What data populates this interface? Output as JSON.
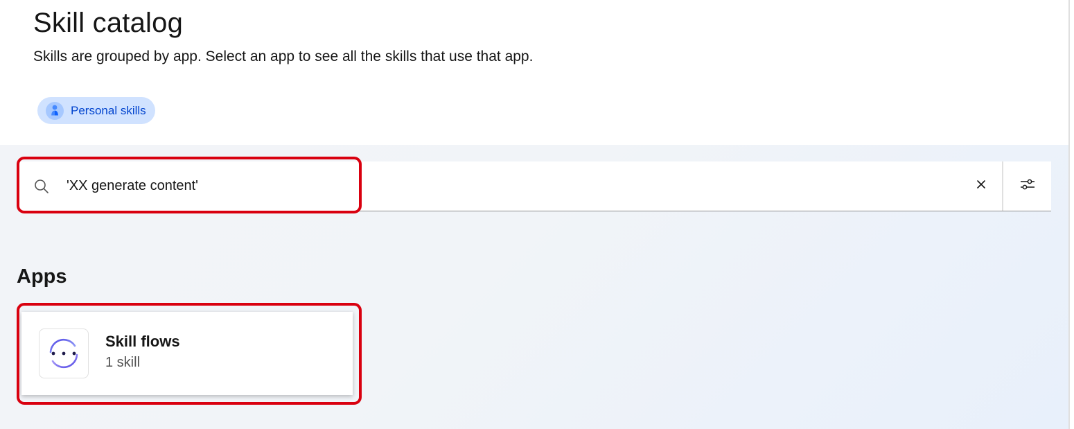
{
  "header": {
    "title": "Skill catalog",
    "subtitle": "Skills are grouped by app. Select an app to see all the skills that use that app.",
    "tag": {
      "label": "Personal skills",
      "icon": "person-icon"
    }
  },
  "search": {
    "value": "'XX generate content'",
    "icon": "search-icon",
    "clear_icon": "close-icon",
    "filter_icon": "sliders-icon"
  },
  "apps": {
    "section_title": "Apps",
    "items": [
      {
        "name": "Skill flows",
        "count": "1 skill",
        "icon": "skill-flows-icon"
      }
    ]
  },
  "colors": {
    "highlight": "#d9000f",
    "tag_bg": "#d0e2ff",
    "tag_text": "#0043ce",
    "icon_accent": "#6366f1"
  }
}
